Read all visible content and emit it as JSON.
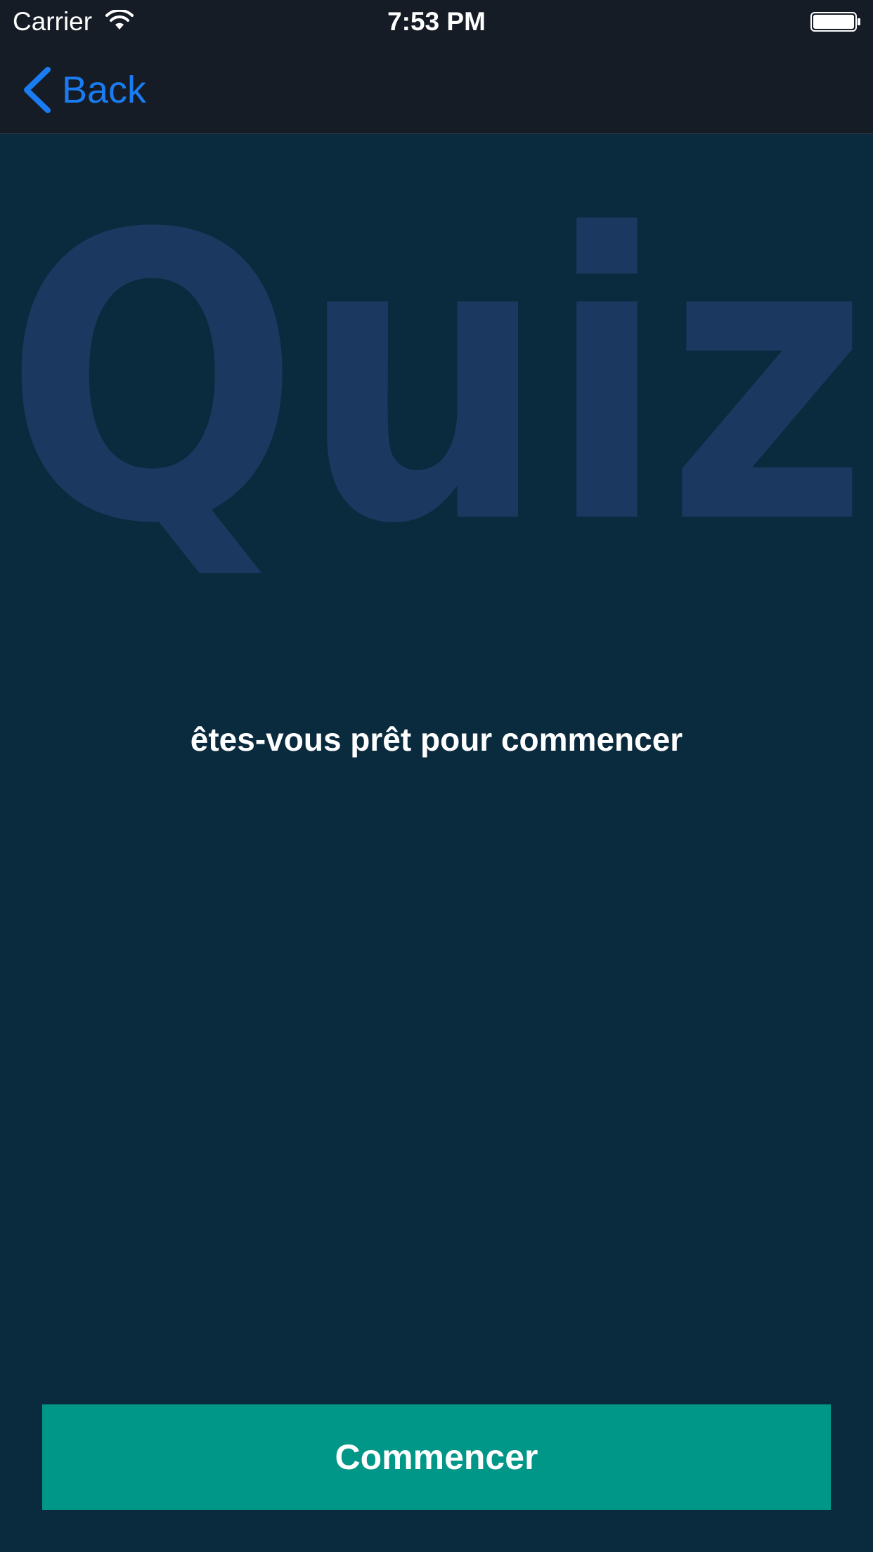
{
  "status_bar": {
    "carrier": "Carrier",
    "time": "7:53 PM",
    "wifi_icon": "wifi-icon",
    "battery_icon": "battery-icon"
  },
  "nav": {
    "back_label": "Back",
    "back_icon": "chevron-left-icon"
  },
  "hero": {
    "watermark_text": "Quiz"
  },
  "main": {
    "prompt": "êtes-vous prêt pour commencer"
  },
  "actions": {
    "start_label": "Commencer"
  },
  "colors": {
    "background": "#0a2a3e",
    "topbar": "#161c26",
    "accent": "#1a7cf2",
    "button": "#009688",
    "watermark": "#1b3960"
  }
}
